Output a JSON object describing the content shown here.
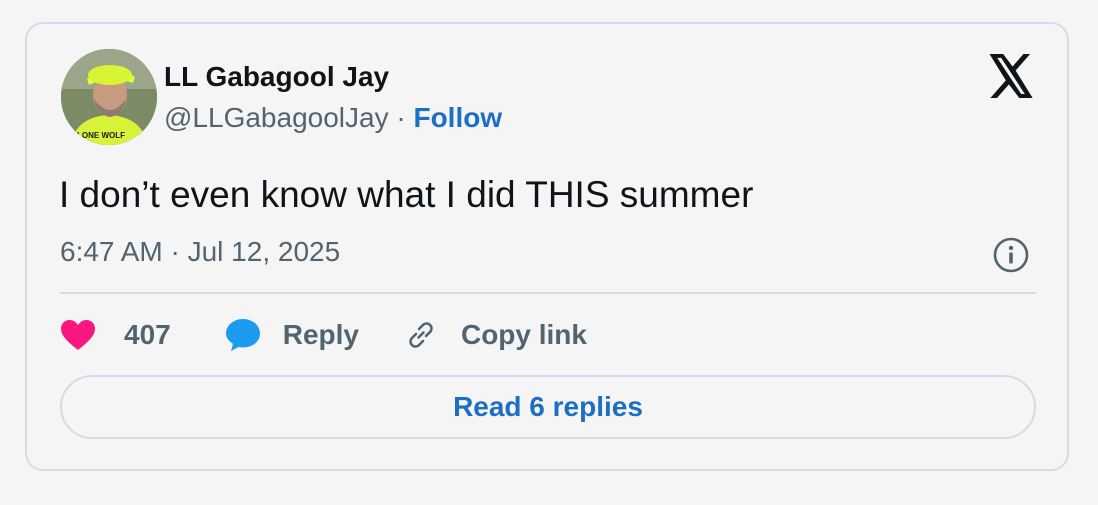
{
  "author": {
    "display_name": "LL Gabagool Jay",
    "handle": "@LLGabagoolJay",
    "separator": "·",
    "follow_label": "Follow",
    "avatar_shirt_text": "LONE WOLF"
  },
  "tweet": {
    "text": "I don’t even know what I did THIS summer",
    "timestamp": "6:47 AM · Jul 12, 2025"
  },
  "actions": {
    "like_count": "407",
    "reply_label": "Reply",
    "copy_link_label": "Copy link"
  },
  "read_replies_label": "Read 6 replies",
  "colors": {
    "like": "#f91880",
    "reply": "#1d9bf0",
    "link": "#1d6fc4",
    "muted": "#536471",
    "text": "#0f1419",
    "border": "#d6dce2"
  }
}
